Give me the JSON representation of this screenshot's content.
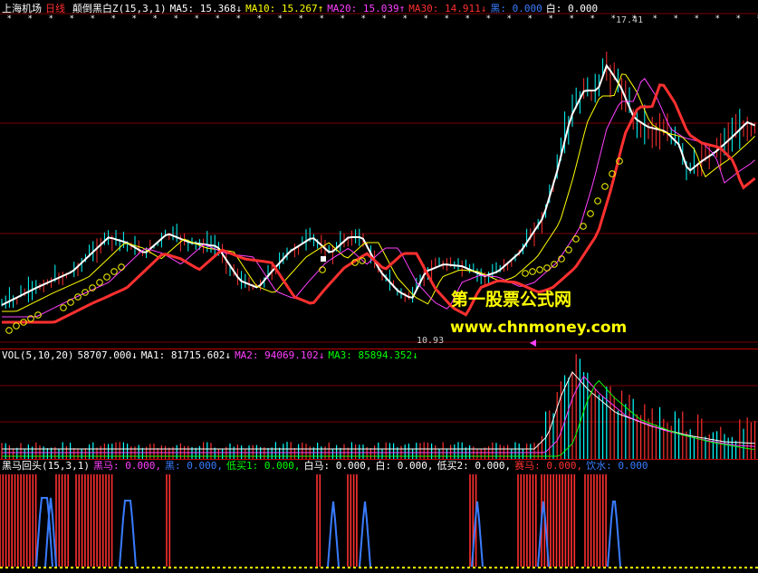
{
  "colors": {
    "red": "#ff3030",
    "white": "#ffffff",
    "yellow": "#ffff00",
    "magenta": "#ff40ff",
    "green": "#00ff00",
    "blue": "#3a7cff",
    "cyan": "#00ffff",
    "grid": "#7a0000"
  },
  "main": {
    "stock": "上海机场",
    "period": "日线",
    "indicator": "颠倒黑白Z(15,3,1)",
    "ma5": "MA5: 15.368↓",
    "ma10": "MA10: 15.267↑",
    "ma20": "MA20: 15.039↑",
    "ma30": "MA30: 14.911↓",
    "hei": "黑: 0.000",
    "bai": "白: 0.000",
    "high_label": "17.41",
    "low_label": "10.93"
  },
  "vol": {
    "name": "VOL(5,10,20)",
    "value": "58707.000↓",
    "ma1": "MA1: 81715.602↓",
    "ma2": "MA2: 94069.102↓",
    "ma3": "MA3: 85894.352↓"
  },
  "sub": {
    "name": "黑马回头(15,3,1)",
    "heima": "黑马: 0.000,",
    "hei": "黑: 0.000,",
    "dimai1": "低买1: 0.000,",
    "baima": "白马: 0.000,",
    "bai": "白: 0.000,",
    "dimai2": "低买2: 0.000,",
    "saima": "赛马: 0.000,",
    "yinshui": "饮水: 0.000"
  },
  "watermark": {
    "line1": "第一股票公式网",
    "line2": "www.chnmoney.com"
  }
}
